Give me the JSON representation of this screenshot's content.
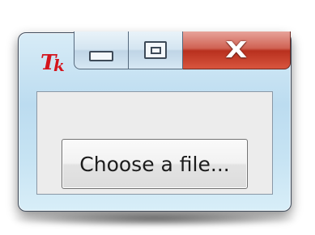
{
  "window": {
    "app_icon": "tk-feather-icon",
    "controls": {
      "minimize_icon": "minimize-icon",
      "maximize_icon": "maximize-icon",
      "close_icon": "close-icon"
    },
    "accent_close": "#c8432f",
    "frame_color": "#c4e1f2"
  },
  "main": {
    "choose_button_label": "Choose a file..."
  }
}
